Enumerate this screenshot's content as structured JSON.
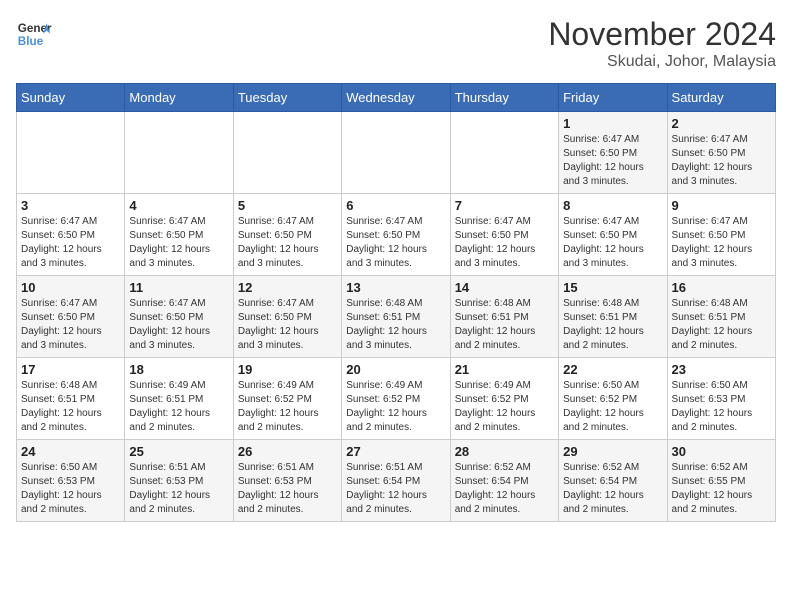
{
  "header": {
    "logo_general": "General",
    "logo_blue": "Blue",
    "month_title": "November 2024",
    "location": "Skudai, Johor, Malaysia"
  },
  "days_of_week": [
    "Sunday",
    "Monday",
    "Tuesday",
    "Wednesday",
    "Thursday",
    "Friday",
    "Saturday"
  ],
  "weeks": [
    [
      {
        "day": "",
        "info": ""
      },
      {
        "day": "",
        "info": ""
      },
      {
        "day": "",
        "info": ""
      },
      {
        "day": "",
        "info": ""
      },
      {
        "day": "",
        "info": ""
      },
      {
        "day": "1",
        "info": "Sunrise: 6:47 AM\nSunset: 6:50 PM\nDaylight: 12 hours and 3 minutes."
      },
      {
        "day": "2",
        "info": "Sunrise: 6:47 AM\nSunset: 6:50 PM\nDaylight: 12 hours and 3 minutes."
      }
    ],
    [
      {
        "day": "3",
        "info": "Sunrise: 6:47 AM\nSunset: 6:50 PM\nDaylight: 12 hours and 3 minutes."
      },
      {
        "day": "4",
        "info": "Sunrise: 6:47 AM\nSunset: 6:50 PM\nDaylight: 12 hours and 3 minutes."
      },
      {
        "day": "5",
        "info": "Sunrise: 6:47 AM\nSunset: 6:50 PM\nDaylight: 12 hours and 3 minutes."
      },
      {
        "day": "6",
        "info": "Sunrise: 6:47 AM\nSunset: 6:50 PM\nDaylight: 12 hours and 3 minutes."
      },
      {
        "day": "7",
        "info": "Sunrise: 6:47 AM\nSunset: 6:50 PM\nDaylight: 12 hours and 3 minutes."
      },
      {
        "day": "8",
        "info": "Sunrise: 6:47 AM\nSunset: 6:50 PM\nDaylight: 12 hours and 3 minutes."
      },
      {
        "day": "9",
        "info": "Sunrise: 6:47 AM\nSunset: 6:50 PM\nDaylight: 12 hours and 3 minutes."
      }
    ],
    [
      {
        "day": "10",
        "info": "Sunrise: 6:47 AM\nSunset: 6:50 PM\nDaylight: 12 hours and 3 minutes."
      },
      {
        "day": "11",
        "info": "Sunrise: 6:47 AM\nSunset: 6:50 PM\nDaylight: 12 hours and 3 minutes."
      },
      {
        "day": "12",
        "info": "Sunrise: 6:47 AM\nSunset: 6:50 PM\nDaylight: 12 hours and 3 minutes."
      },
      {
        "day": "13",
        "info": "Sunrise: 6:48 AM\nSunset: 6:51 PM\nDaylight: 12 hours and 3 minutes."
      },
      {
        "day": "14",
        "info": "Sunrise: 6:48 AM\nSunset: 6:51 PM\nDaylight: 12 hours and 2 minutes."
      },
      {
        "day": "15",
        "info": "Sunrise: 6:48 AM\nSunset: 6:51 PM\nDaylight: 12 hours and 2 minutes."
      },
      {
        "day": "16",
        "info": "Sunrise: 6:48 AM\nSunset: 6:51 PM\nDaylight: 12 hours and 2 minutes."
      }
    ],
    [
      {
        "day": "17",
        "info": "Sunrise: 6:48 AM\nSunset: 6:51 PM\nDaylight: 12 hours and 2 minutes."
      },
      {
        "day": "18",
        "info": "Sunrise: 6:49 AM\nSunset: 6:51 PM\nDaylight: 12 hours and 2 minutes."
      },
      {
        "day": "19",
        "info": "Sunrise: 6:49 AM\nSunset: 6:52 PM\nDaylight: 12 hours and 2 minutes."
      },
      {
        "day": "20",
        "info": "Sunrise: 6:49 AM\nSunset: 6:52 PM\nDaylight: 12 hours and 2 minutes."
      },
      {
        "day": "21",
        "info": "Sunrise: 6:49 AM\nSunset: 6:52 PM\nDaylight: 12 hours and 2 minutes."
      },
      {
        "day": "22",
        "info": "Sunrise: 6:50 AM\nSunset: 6:52 PM\nDaylight: 12 hours and 2 minutes."
      },
      {
        "day": "23",
        "info": "Sunrise: 6:50 AM\nSunset: 6:53 PM\nDaylight: 12 hours and 2 minutes."
      }
    ],
    [
      {
        "day": "24",
        "info": "Sunrise: 6:50 AM\nSunset: 6:53 PM\nDaylight: 12 hours and 2 minutes."
      },
      {
        "day": "25",
        "info": "Sunrise: 6:51 AM\nSunset: 6:53 PM\nDaylight: 12 hours and 2 minutes."
      },
      {
        "day": "26",
        "info": "Sunrise: 6:51 AM\nSunset: 6:53 PM\nDaylight: 12 hours and 2 minutes."
      },
      {
        "day": "27",
        "info": "Sunrise: 6:51 AM\nSunset: 6:54 PM\nDaylight: 12 hours and 2 minutes."
      },
      {
        "day": "28",
        "info": "Sunrise: 6:52 AM\nSunset: 6:54 PM\nDaylight: 12 hours and 2 minutes."
      },
      {
        "day": "29",
        "info": "Sunrise: 6:52 AM\nSunset: 6:54 PM\nDaylight: 12 hours and 2 minutes."
      },
      {
        "day": "30",
        "info": "Sunrise: 6:52 AM\nSunset: 6:55 PM\nDaylight: 12 hours and 2 minutes."
      }
    ]
  ]
}
